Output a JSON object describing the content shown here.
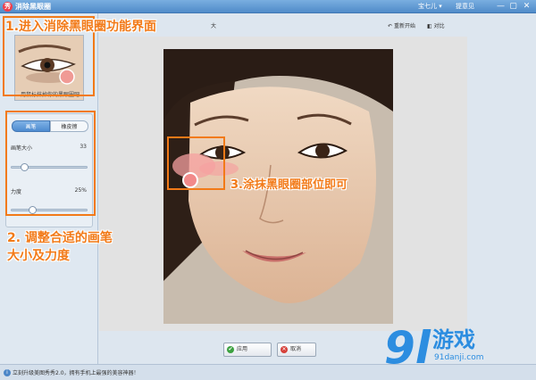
{
  "window": {
    "title": "消除黑眼圈",
    "user_menu": "宝七儿 ▾",
    "feedback": "提意见",
    "min_icon": "—",
    "max_icon": "▢",
    "close_icon": "✕"
  },
  "left_panel": {
    "thumb_label": "用鼠标抹掉你的黑眼圈吧",
    "tabs": [
      "画笔",
      "橡皮擦"
    ],
    "brush_size": {
      "label": "画笔大小",
      "value": "33",
      "level": 0.17
    },
    "strength": {
      "label": "力度",
      "value": "25%",
      "level": 0.25
    }
  },
  "toolbar": {
    "title_tail": "大",
    "reset_label": "重新开始",
    "compare_label": "对比"
  },
  "annotations": {
    "step1": "1.进入消除黑眼圈功能界面",
    "step2_line1": "2. 调整合适的画笔",
    "step2_line2": "大小及力度",
    "step3": "3.涂抹黑眼圈部位即可"
  },
  "buttons": {
    "apply": "应用",
    "cancel": "取消"
  },
  "status": {
    "text": "立刻升级美图秀秀2.0，拥有手机上最强的美容神器！"
  },
  "watermark": {
    "number": "9l",
    "text": "游戏",
    "domain": "91danji.com"
  },
  "colors": {
    "accent": "#f27a18",
    "titlebar": "#4f8bc9",
    "brand": "#2c8de0"
  }
}
